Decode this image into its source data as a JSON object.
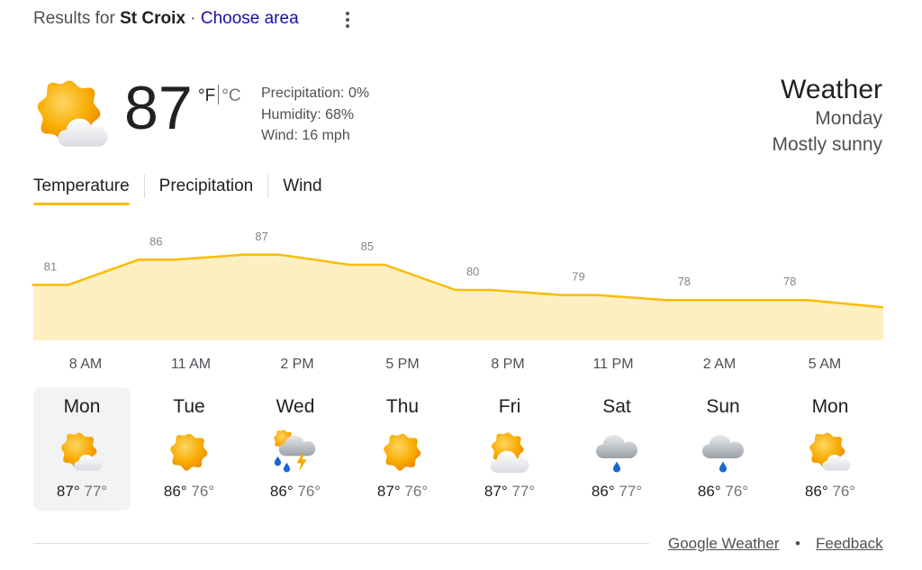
{
  "header": {
    "results_prefix": "Results for",
    "location": "St Croix",
    "dot": "·",
    "choose_area": "Choose area"
  },
  "current": {
    "icon": "partly-sunny-icon",
    "temperature": "87",
    "unit_f": "°F",
    "unit_c": "°C",
    "precipitation": "Precipitation: 0%",
    "humidity": "Humidity: 68%",
    "wind": "Wind: 16 mph"
  },
  "summary": {
    "title": "Weather",
    "day": "Monday",
    "condition": "Mostly sunny"
  },
  "tabs": [
    "Temperature",
    "Precipitation",
    "Wind"
  ],
  "colors": {
    "accent": "#fbbc04",
    "fill": "#feefc3",
    "sun": "#f9ab00",
    "rain": "#1967d2"
  },
  "chart_data": {
    "type": "area",
    "x": [
      "8 AM",
      "11 AM",
      "2 PM",
      "5 PM",
      "8 PM",
      "11 PM",
      "2 AM",
      "5 AM"
    ],
    "series": [
      {
        "values": [
          81,
          86,
          87,
          85,
          80,
          79,
          78,
          78
        ]
      }
    ],
    "data_labels": [
      "81",
      "86",
      "87",
      "85",
      "80",
      "79",
      "78",
      "78"
    ]
  },
  "days": [
    {
      "name": "Mon",
      "icon": "partly-sunny-icon",
      "hi": "87°",
      "lo": "77°"
    },
    {
      "name": "Tue",
      "icon": "sunny-icon",
      "hi": "86°",
      "lo": "76°"
    },
    {
      "name": "Wed",
      "icon": "scattered-thunderstorms-icon",
      "hi": "86°",
      "lo": "76°"
    },
    {
      "name": "Thu",
      "icon": "sunny-icon",
      "hi": "87°",
      "lo": "76°"
    },
    {
      "name": "Fri",
      "icon": "partly-sunny-icon",
      "hi": "87°",
      "lo": "77°"
    },
    {
      "name": "Sat",
      "icon": "rain-icon",
      "hi": "86°",
      "lo": "77°"
    },
    {
      "name": "Sun",
      "icon": "rain-icon",
      "hi": "86°",
      "lo": "76°"
    },
    {
      "name": "Mon",
      "icon": "partly-sunny-icon",
      "hi": "86°",
      "lo": "76°"
    }
  ],
  "footer": {
    "source": "Google Weather",
    "dot": "•",
    "feedback": "Feedback"
  }
}
